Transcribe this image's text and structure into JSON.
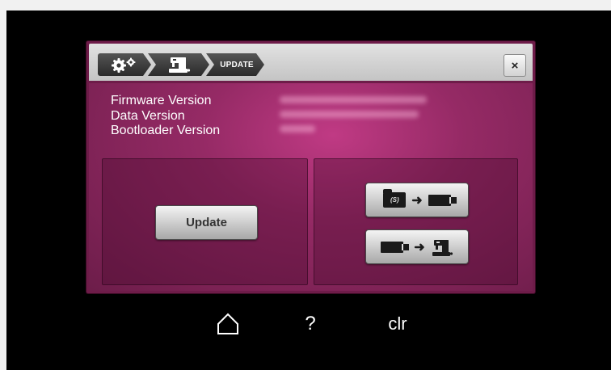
{
  "breadcrumb": {
    "items": [
      {
        "icon": "gears-icon"
      },
      {
        "icon": "sewing-machine-icon"
      },
      {
        "label": "UPDATE"
      }
    ]
  },
  "close": {
    "label": "×"
  },
  "info": {
    "firmware_label": "Firmware Version",
    "data_label": "Data Version",
    "bootloader_label": "Bootloader Version"
  },
  "update_button": {
    "label": "Update"
  },
  "transfer_buttons": {
    "folder_icon_text": "(S)",
    "items": [
      {
        "from": "folder-icon",
        "to": "usb-stick-icon"
      },
      {
        "from": "usb-stick-icon",
        "to": "sewing-machine-icon"
      }
    ]
  },
  "navbar": {
    "home_icon": "home-icon",
    "help_label": "?",
    "clear_label": "clr"
  },
  "colors": {
    "dialog_bg": "#6e1c49",
    "content_center": "#c03a84",
    "titlebar": "#d4d4d4"
  }
}
